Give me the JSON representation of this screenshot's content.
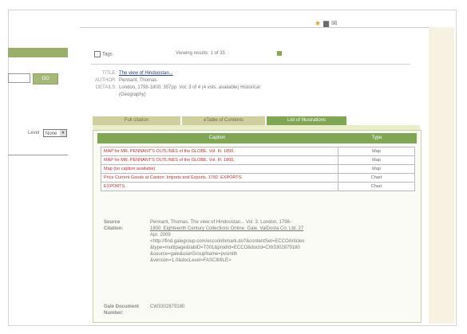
{
  "toolbar": {
    "icons": [
      "star-icon",
      "print-icon",
      "mail-icon"
    ]
  },
  "left": {
    "go_label": "GO",
    "level_label": "Level",
    "level_value": "None"
  },
  "results_bar": {
    "tag_label": "Tags",
    "viewing": "Viewing results: 1 of 35"
  },
  "meta": {
    "title_key": "TITLE:",
    "title_value": "The view of Hindoostan...",
    "author_key": "AUTHOR:",
    "author_value": "Pennant, Thomas.",
    "details_key": "DETAILS:",
    "details_line1": "London, 1798-1800. 357pp. Vol. 3 of 4 (4 vols. available) Historical",
    "details_line2": "(Geography)"
  },
  "tabs": {
    "full_citation": "Full citation",
    "table_of_contents": "eTable of Contents",
    "list_of_illustrations": "List of Illustrations"
  },
  "table": {
    "caption_header": "Caption",
    "type_header": "Type",
    "rows": [
      {
        "caption": "MAP for MR. PENNANT'S OUTLINES of the GLOBE. Vol. III. 1800.",
        "type": "Map"
      },
      {
        "caption": "MAP for MR. PENNANT'S OUTLINES of the GLOBE. Vol. III. 1800.",
        "type": "Map"
      },
      {
        "caption": "Map (no caption available)",
        "type": "Map"
      },
      {
        "caption": "Price Current Goods at Canton: Imports and Exports. 1792. EXPORTS.",
        "type": "Chart"
      },
      {
        "caption": "EXPORTS.",
        "type": "Chart"
      }
    ]
  },
  "citation": {
    "label": "Source Citation:",
    "line1": "Pennant, Thomas. The view of Hindoostan... Vol. 3. London, 1798-",
    "line2": "1800. Eighteenth Century Collections Online. Gale. ValDosta Co. Ltd. 27",
    "line3": "Apr. 2009",
    "line4": "<http://find.galegroup.com/ecco/infomark.do?&contentSet=ECCOArticles",
    "line5": "&type=multipage&tabID=T001&prodId=ECCO&docId=CW3302879180",
    "line6": "&source=gale&userGroupName=pvsmith",
    "line7": "&version=1.0&docLevel=FASCIMILE>"
  },
  "doc_number": {
    "label_line1": "Gale Document",
    "label_line2": "Number:",
    "value": "CW3302879180"
  }
}
